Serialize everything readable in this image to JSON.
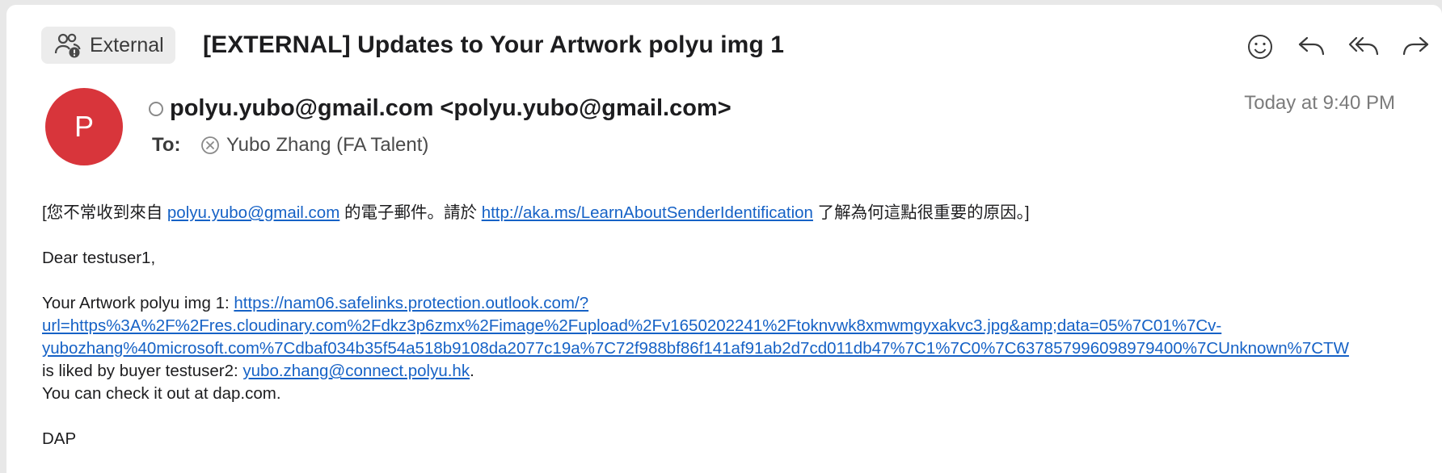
{
  "header": {
    "badge_label": "External",
    "subject": "[EXTERNAL] Updates to Your Artwork polyu img 1",
    "actions": [
      "emoji-reaction",
      "reply",
      "reply-all",
      "forward"
    ]
  },
  "sender": {
    "avatar_initial": "P",
    "avatar_color": "#d8353b",
    "from": "polyu.yubo@gmail.com <polyu.yubo@gmail.com>",
    "date": "Today at 9:40 PM",
    "to_label": "To:",
    "to_recipient": "Yubo Zhang (FA Talent)"
  },
  "body": {
    "notice_prefix": "[您不常收到來自 ",
    "notice_email": "polyu.yubo@gmail.com",
    "notice_middle": " 的電子郵件。請於 ",
    "notice_link": "http://aka.ms/LearnAboutSenderIdentification",
    "notice_suffix": " 了解為何這點很重要的原因。]",
    "greeting": "Dear testuser1,",
    "artwork_prefix": "Your Artwork polyu img 1: ",
    "safelink_line1": "https://nam06.safelinks.protection.outlook.com/?",
    "safelink_line2": "url=https%3A%2F%2Fres.cloudinary.com%2Fdkz3p6zmx%2Fimage%2Fupload%2Fv1650202241%2Ftoknvwk8xmwmgyxakvc3.jpg&amp;data=05%7C01%7Cv-",
    "safelink_line3": "yubozhang%40microsoft.com%7Cdbaf034b35f54a518b9108da2077c19a%7C72f988bf86f141af91ab2d7cd011db47%7C1%7C0%7C637857996098979400%7CUnknown%7CTW",
    "liked_prefix": "is liked by buyer testuser2: ",
    "buyer_email": "yubo.zhang@connect.polyu.hk",
    "liked_suffix": ".",
    "check_line": "You can check it out at dap.com.",
    "signature": "DAP"
  },
  "colors": {
    "link": "#1662c6",
    "avatar": "#d8353b",
    "badge_bg": "#ececec"
  }
}
